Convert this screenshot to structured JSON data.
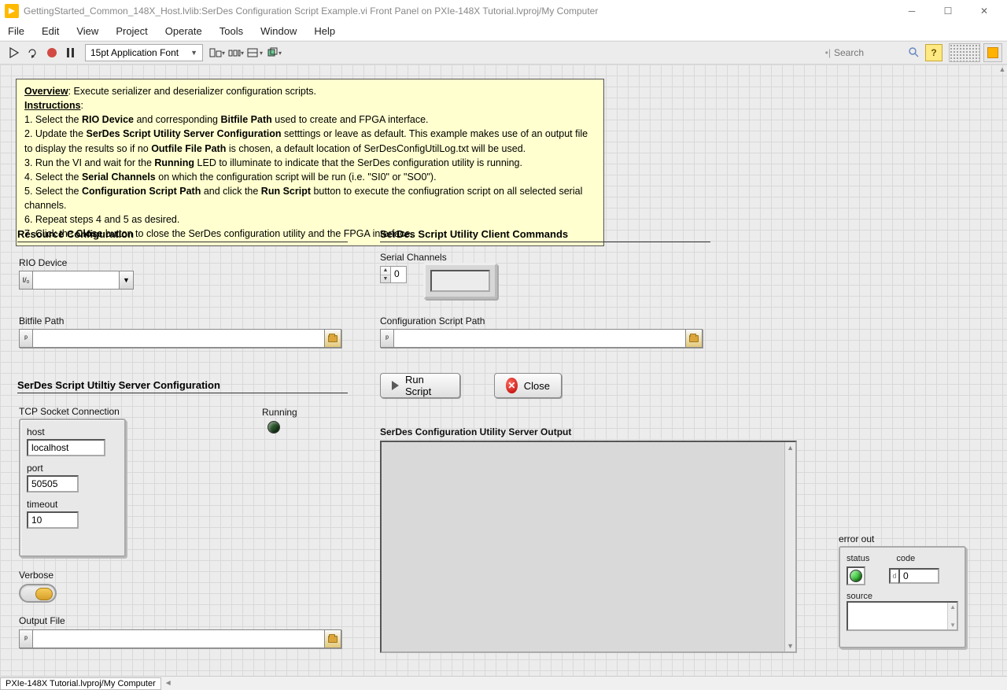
{
  "window": {
    "title": "GettingStarted_Common_148X_Host.lvlib:SerDes Configuration Script Example.vi Front Panel on PXIe-148X Tutorial.lvproj/My Computer"
  },
  "menu": [
    "File",
    "Edit",
    "View",
    "Project",
    "Operate",
    "Tools",
    "Window",
    "Help"
  ],
  "toolbar": {
    "font": "15pt Application Font",
    "search_placeholder": "Search"
  },
  "info": {
    "overview_label": "Overview",
    "overview_text": ": Execute serializer and deserializer configuration scripts.",
    "instructions_label": "Instructions",
    "lines": {
      "l1a": " 1. Select the ",
      "l1b": "RIO Device",
      "l1c": " and corresponding ",
      "l1d": "Bitfile Path",
      "l1e": " used to create and FPGA interface.",
      "l2a": " 2. Update the ",
      "l2b": "SerDes Script Utility Server Configuration",
      "l2c": " setttings or leave as default. This example makes use of an output file to display the results so if no ",
      "l2d": "Outfile File Path",
      "l2e": " is chosen, a default location of SerDesConfigUtilLog.txt will be used.",
      "l3a": " 3. Run the VI and wait for the ",
      "l3b": "Running",
      "l3c": " LED to illuminate to indicate that the SerDes configuration utility is running.",
      "l4a": " 4. Select the ",
      "l4b": "Serial Channels",
      "l4c": " on which the configuration script will be run (i.e. \"SI0\" or \"SO0\").",
      "l5a": " 5. Select the ",
      "l5b": "Configuration Script Path",
      "l5c": " and click the ",
      "l5d": "Run Script",
      "l5e": " button to execute the confiugration script on all selected serial channels.",
      "l6": " 6. Repeat steps 4 and 5 as desired.",
      "l7a": " 7. Click the ",
      "l7b": "Close",
      "l7c": " button to close the SerDes configuration utility and the FPGA interface."
    }
  },
  "sections": {
    "resource": "Resource Configuration",
    "server": "SerDes Script Utiltiy Server Configuration",
    "client": "SerDes Script Utility Client Commands",
    "output": "SerDes Configuration Utility Server Output"
  },
  "labels": {
    "rio": "RIO Device",
    "bitpath": "Bitfile Path",
    "tcp": "TCP Socket Connection",
    "host": "host",
    "port": "port",
    "timeout": "timeout",
    "verbose": "Verbose",
    "outfile": "Output File",
    "running": "Running",
    "serial": "Serial Channels",
    "cfgpath": "Configuration Script Path",
    "errorout": "error out",
    "status": "status",
    "code": "code",
    "source": "source"
  },
  "values": {
    "host": "localhost",
    "port": "50505",
    "timeout": "10",
    "serial_index": "0",
    "code": "0"
  },
  "buttons": {
    "runscript": "Run Script",
    "close": "Close"
  },
  "status": {
    "project": "PXIe-148X Tutorial.lvproj/My Computer"
  }
}
